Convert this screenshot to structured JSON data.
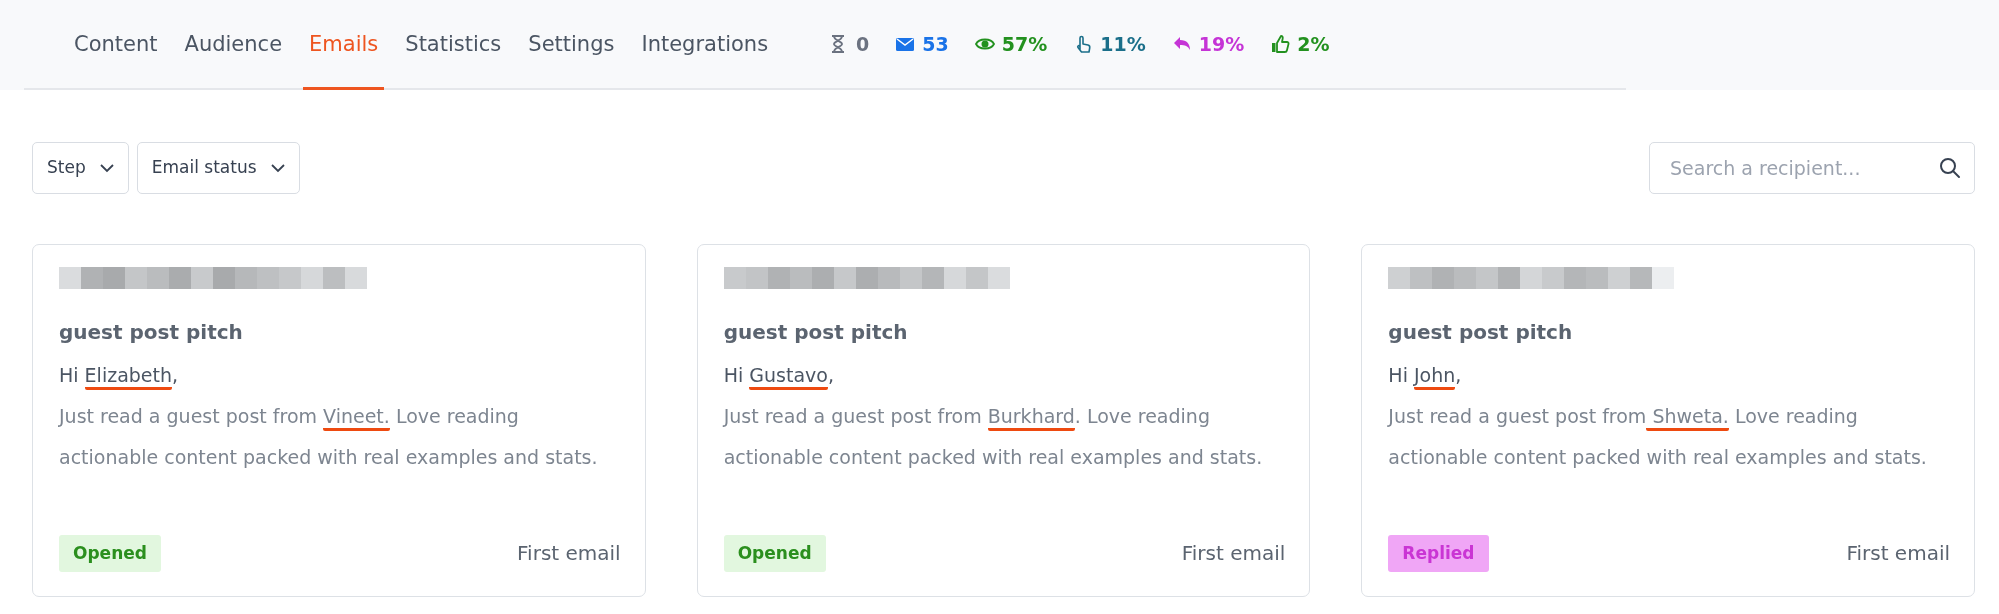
{
  "tabs": [
    {
      "label": "Content",
      "selected": false
    },
    {
      "label": "Audience",
      "selected": false
    },
    {
      "label": "Emails",
      "selected": true
    },
    {
      "label": "Statistics",
      "selected": false
    },
    {
      "label": "Settings",
      "selected": false
    },
    {
      "label": "Integrations",
      "selected": false
    }
  ],
  "stats": [
    {
      "kind": "pending",
      "value": "0",
      "color": "#6b7280"
    },
    {
      "kind": "sent",
      "value": "53",
      "color": "#1a73e8"
    },
    {
      "kind": "opened",
      "value": "57%",
      "color": "#23911f"
    },
    {
      "kind": "clicked",
      "value": "11%",
      "color": "#1b6f8a"
    },
    {
      "kind": "replied",
      "value": "19%",
      "color": "#c534d6"
    },
    {
      "kind": "interested",
      "value": "2%",
      "color": "#23911f"
    }
  ],
  "filters": [
    {
      "label": "Step"
    },
    {
      "label": "Email status"
    }
  ],
  "search": {
    "placeholder": "Search a recipient..."
  },
  "cards": [
    {
      "subject": "guest post pitch",
      "greeting": [
        {
          "text": "Hi "
        },
        {
          "text": "Elizabeth",
          "flagged": true
        },
        {
          "text": ","
        }
      ],
      "body": [
        {
          "text": "Just read a guest post from "
        },
        {
          "text": "Vineet.",
          "flagged": true
        },
        {
          "text": " Love reading actionable content packed with real examples and stats."
        }
      ],
      "status": {
        "label": "Opened",
        "color": "#e2f7df"
      },
      "step": "First email"
    },
    {
      "subject": "guest post pitch",
      "greeting": [
        {
          "text": "Hi "
        },
        {
          "text": "Gustavo",
          "flagged": true
        },
        {
          "text": ","
        }
      ],
      "body": [
        {
          "text": "Just read a guest post from "
        },
        {
          "text": "Burkhard",
          "flagged": true
        },
        {
          "text": ". Love reading actionable content packed with real examples and stats."
        }
      ],
      "status": {
        "label": "Opened",
        "color": "#e2f7df"
      },
      "step": "First email"
    },
    {
      "subject": "guest post pitch",
      "greeting": [
        {
          "text": "Hi "
        },
        {
          "text": "John",
          "flagged": true
        },
        {
          "text": ","
        }
      ],
      "body": [
        {
          "text": "Just read a guest post from"
        },
        {
          "text": " Shweta.",
          "flagged": true
        },
        {
          "text": " Love reading actionable content packed with real examples and stats."
        }
      ],
      "status": {
        "label": "Replied",
        "color": "#f0a6f6"
      },
      "step": "First email"
    }
  ]
}
